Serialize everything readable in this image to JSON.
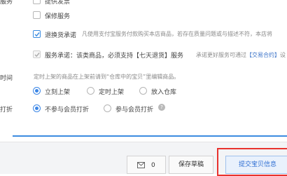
{
  "top_cut": {
    "left_label": "服务",
    "item0": "提供发票"
  },
  "services": {
    "warranty": {
      "label": "保修服务"
    },
    "return": {
      "label": "退换货承诺",
      "description": "凡使用支付宝服务付款购买本店商品，若存在质量问题或与描述不符，本店将"
    },
    "commitment": {
      "label": "服务承诺：该类商品，必须支持【七天退货】服务",
      "note_prefix": "承诺更好服务可通过",
      "note_link": "【交易合约】",
      "note_suffix": "设"
    }
  },
  "listing_time": {
    "label": "时间",
    "hint": "定时上架的商品在上架前请到“仓库中的宝贝”里编辑商品。",
    "options": [
      "立刻上架",
      "定时上架",
      "放入仓库"
    ],
    "selected": "立刻上架"
  },
  "member_discount": {
    "label": "打折",
    "options": [
      "不参与会员打折",
      "参与会员打折"
    ],
    "selected": "不参与会员打折"
  },
  "footer": {
    "message_count": "0",
    "save_draft_label": "保存草稿",
    "submit_label": "提交宝贝信息"
  },
  "colors": {
    "accent": "#3c8ce0",
    "submit_highlight": "#e8332f"
  }
}
